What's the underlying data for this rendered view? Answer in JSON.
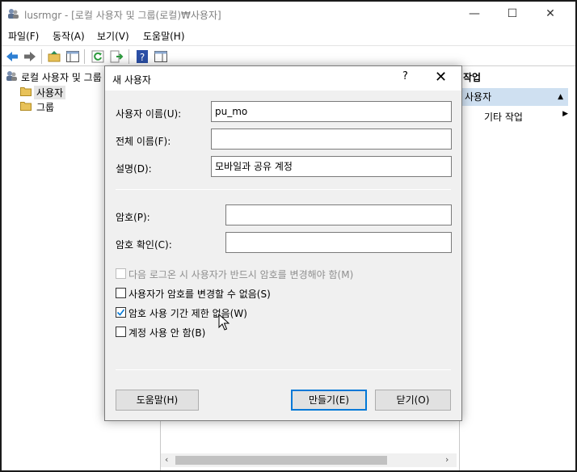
{
  "window": {
    "title": "lusrmgr - [로컬 사용자 및 그룹(로컬)₩사용자]",
    "minimize": "—",
    "maximize": "☐",
    "close": "✕"
  },
  "menubar": {
    "items": [
      "파일(F)",
      "동작(A)",
      "보기(V)",
      "도움말(H)"
    ]
  },
  "toolbar": {
    "icons": [
      "back-arrow-icon",
      "forward-arrow-icon",
      "up-folder-icon",
      "show-hide-tree-icon",
      "refresh-icon",
      "export-list-icon",
      "help-icon",
      "properties-icon"
    ]
  },
  "tree": {
    "root": "로컬 사용자 및 그룹",
    "items": [
      "사용자",
      "그룹"
    ],
    "selected": "사용자"
  },
  "actions": {
    "header": "작업",
    "selected": "사용자",
    "other": "기타 작업",
    "caret_up": "▲",
    "arrow_right": "▶"
  },
  "scrollbar": {
    "left": "‹",
    "right": "›"
  },
  "dialog": {
    "title": "새 사용자",
    "help": "?",
    "close": "✕",
    "username_label": "사용자 이름(U):",
    "username_value": "pu_mo",
    "fullname_label": "전체 이름(F):",
    "fullname_value": "",
    "description_label": "설명(D):",
    "description_value": "모바일과 공유 계정",
    "password_label": "암호(P):",
    "password_value": "",
    "confirm_label": "암호 확인(C):",
    "confirm_value": "",
    "checkboxes": [
      {
        "label": "다음 로그온 시 사용자가 반드시 암호를 변경해야 함(M)",
        "checked": false,
        "disabled": true
      },
      {
        "label": "사용자가 암호를 변경할 수 없음(S)",
        "checked": false,
        "disabled": false
      },
      {
        "label": "암호 사용 기간 제한 없음(W)",
        "checked": true,
        "disabled": false
      },
      {
        "label": "계정 사용 안 함(B)",
        "checked": false,
        "disabled": false
      }
    ],
    "check_mark": "✓",
    "help_button": "도움말(H)",
    "create_button": "만들기(E)",
    "close_button": "닫기(O)"
  },
  "colors": {
    "accent": "#0078d7",
    "selection": "#cfe0f1",
    "dialog_bg": "#f0f0f0",
    "folder": "#e8c25a"
  }
}
